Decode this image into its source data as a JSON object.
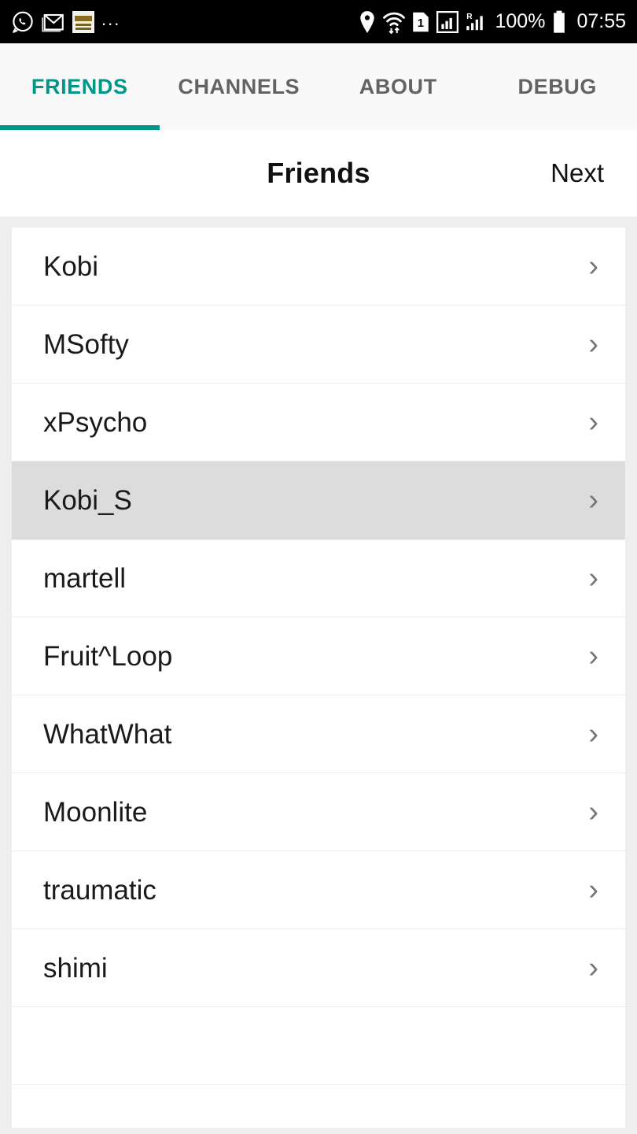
{
  "status_bar": {
    "left_icons": [
      "whatsapp-icon",
      "gmail-icon",
      "news-app-icon"
    ],
    "overflow": "...",
    "right_icons": [
      "location-pin-icon",
      "wifi-icon",
      "sim-1-icon",
      "signal-bars-icon",
      "roaming-signal-icon"
    ],
    "battery_percent": "100%",
    "battery_icon": "battery-full-icon",
    "clock": "07:55"
  },
  "tabs": [
    {
      "label": "FRIENDS",
      "active": true
    },
    {
      "label": "CHANNELS",
      "active": false
    },
    {
      "label": "ABOUT",
      "active": false
    },
    {
      "label": "DEBUG",
      "active": false
    }
  ],
  "header": {
    "title": "Friends",
    "next_label": "Next"
  },
  "friends": [
    {
      "name": "Kobi",
      "selected": false
    },
    {
      "name": "MSofty",
      "selected": false
    },
    {
      "name": "xPsycho",
      "selected": false
    },
    {
      "name": "Kobi_S",
      "selected": true
    },
    {
      "name": "martell",
      "selected": false
    },
    {
      "name": "Fruit^Loop",
      "selected": false
    },
    {
      "name": "WhatWhat",
      "selected": false
    },
    {
      "name": "Moonlite",
      "selected": false
    },
    {
      "name": "traumatic",
      "selected": false
    },
    {
      "name": "shimi",
      "selected": false
    }
  ],
  "chevron_glyph": "›",
  "colors": {
    "accent": "#009688",
    "tab_inactive": "#636363",
    "selected_row": "#dcdcdc",
    "page_background": "#eeeeee",
    "status_bar": "#000000"
  }
}
